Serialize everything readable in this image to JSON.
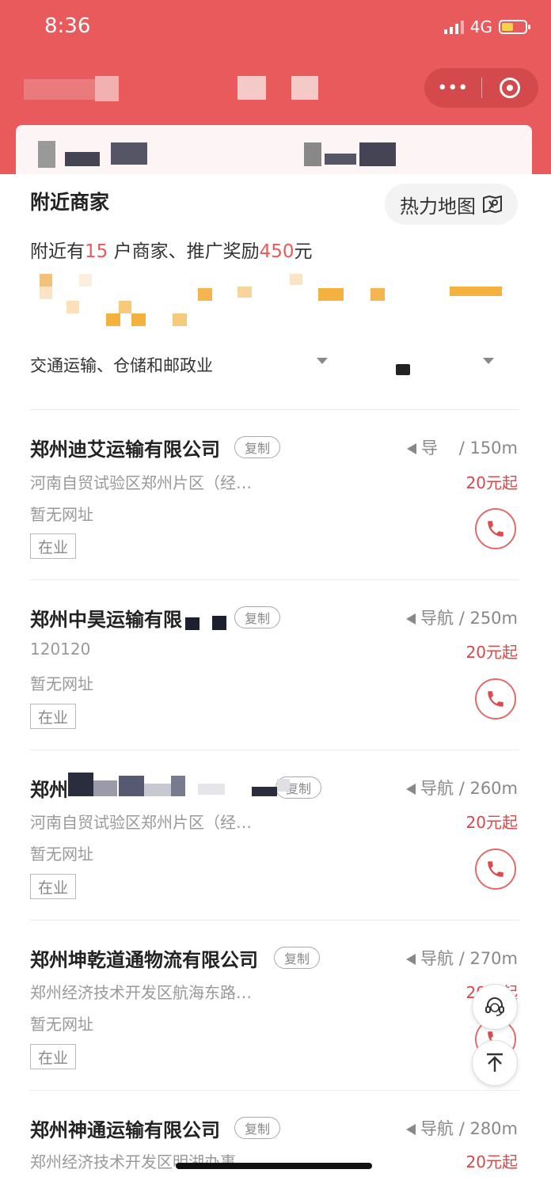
{
  "status_bar": {
    "time": "8:36",
    "network": "4G"
  },
  "capsule": {
    "more_icon": "ellipsis-icon",
    "close_icon": "target-icon"
  },
  "nearby": {
    "title": "附近商家",
    "heatmap_label": "热力地图",
    "summary_prefix": "附近有",
    "merchant_count": "15",
    "summary_mid": " 户商家、推广奖励",
    "reward": "450",
    "summary_suffix": "元"
  },
  "filter": {
    "industry": "交通运输、仓储和邮政业"
  },
  "merchants": [
    {
      "name": "郑州迪艾运输有限公司",
      "copy": "复制",
      "nav": "导",
      "distance": "150m",
      "address": "河南自贸试验区郑州片区（经…",
      "price": "20元起",
      "website": "暂无网址",
      "status": "在业"
    },
    {
      "name": "郑州中昊运输有限",
      "copy": "复制",
      "nav": "导航",
      "distance": "250m",
      "address": "120120",
      "price": "20元起",
      "website": "暂无网址",
      "status": "在业"
    },
    {
      "name": "郑州",
      "copy": "复制",
      "nav": "导航",
      "distance": "260m",
      "address": "河南自贸试验区郑州片区（经…",
      "price": "20元起",
      "website": "暂无网址",
      "status": "在业"
    },
    {
      "name": "郑州坤乾道通物流有限公司",
      "copy": "复制",
      "nav": "导航",
      "distance": "270m",
      "address": "郑州经济技术开发区航海东路…",
      "price": "20元起",
      "website": "暂无网址",
      "status": "在业"
    },
    {
      "name": "郑州神通运输有限公司",
      "copy": "复制",
      "nav": "导航",
      "distance": "280m",
      "address": "郑州经济技术开发区明湖办事…",
      "price": "20元起"
    }
  ],
  "distance_separator": " / ",
  "colors": {
    "header": "#e85a5c",
    "accent": "#e85a5c",
    "price": "#d8484a"
  }
}
